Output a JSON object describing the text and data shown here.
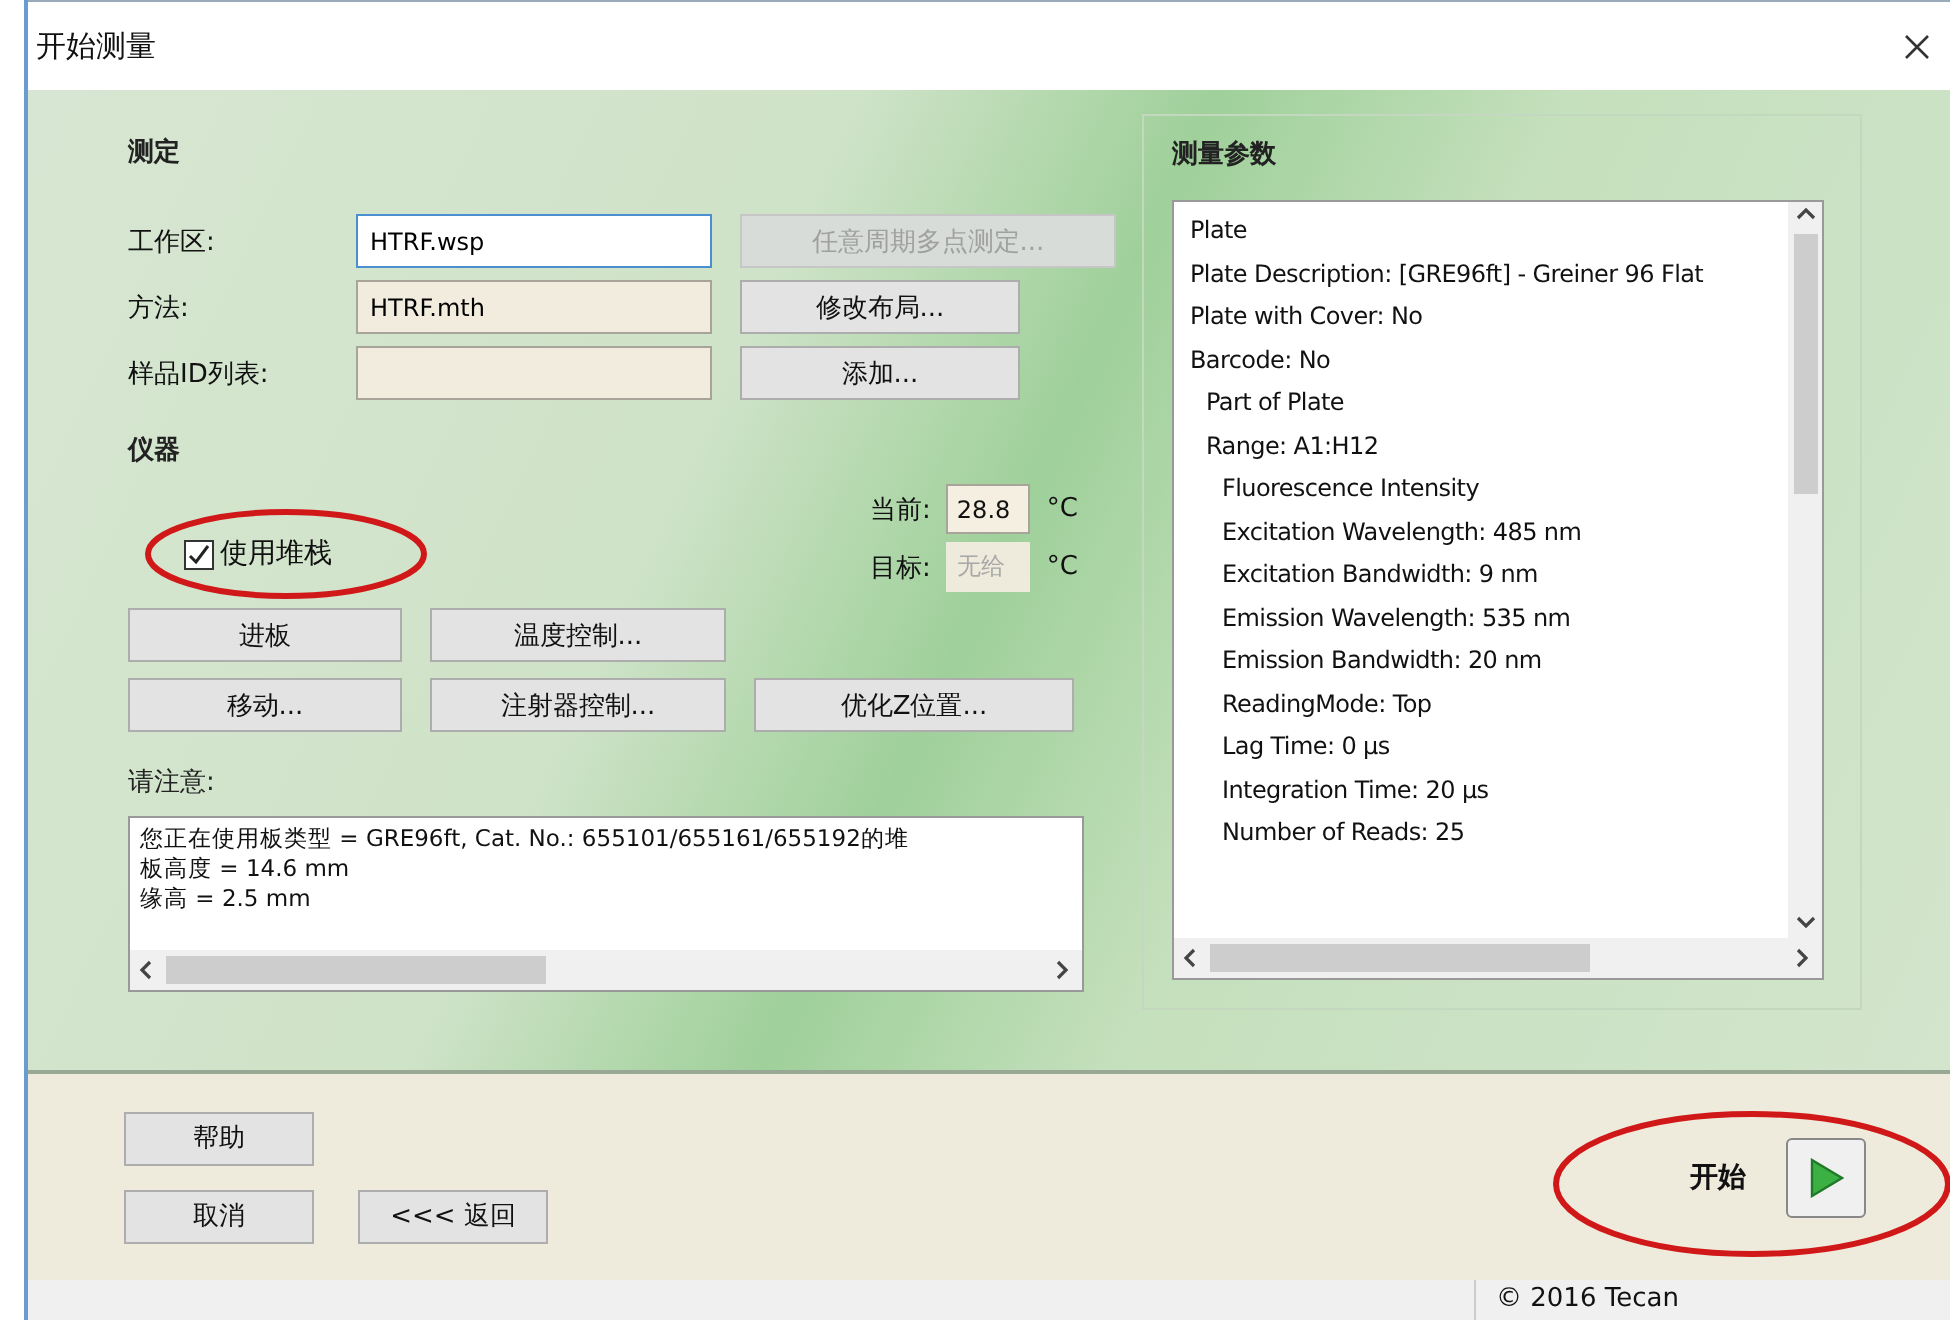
{
  "window": {
    "title": "开始测量"
  },
  "measurement": {
    "heading": "测定",
    "fields": [
      {
        "label": "工作区:",
        "value": "HTRF.wsp",
        "focused": true,
        "button": {
          "label": "任意周期多点测定...",
          "disabled": true
        }
      },
      {
        "label": "方法:",
        "value": "HTRF.mth",
        "focused": false,
        "button": {
          "label": "修改布局...",
          "disabled": false
        }
      },
      {
        "label": "样品ID列表:",
        "focused": false,
        "button": {
          "label": "添加...",
          "disabled": false
        }
      }
    ]
  },
  "instrument": {
    "heading": "仪器",
    "stacker": {
      "label": "使用堆栈",
      "checked": true
    },
    "current": {
      "label": "当前:",
      "value": "28.8",
      "unit": "°C",
      "disabled": false
    },
    "target": {
      "label": "目标:",
      "value": "无给",
      "unit": "°C",
      "disabled": true
    },
    "button_rows": [
      [
        {
          "label": "进板"
        },
        {
          "label": "温度控制..."
        }
      ],
      [
        {
          "label": "移动..."
        },
        {
          "label": "注射器控制..."
        },
        {
          "label": "优化Z位置..."
        }
      ]
    ]
  },
  "notes": {
    "heading": "请注意:",
    "lines": [
      "您正在使用板类型 = GRE96ft, Cat. No.: 655101/655161/655192的堆",
      "板高度 = 14.6 mm",
      "缘高 = 2.5 mm"
    ]
  },
  "parameters": {
    "heading": "测量参数",
    "items": [
      {
        "label": "Plate"
      },
      {
        "label": "Plate Description: [GRE96ft] - Greiner 96 Flat"
      },
      {
        "label": "Plate with Cover: No"
      },
      {
        "label": "Barcode: No",
        "children": [
          {
            "label": "Part of Plate"
          },
          {
            "label": "Range: A1:H12",
            "children": [
              {
                "label": "Fluorescence Intensity"
              },
              {
                "label": "Excitation Wavelength: 485 nm"
              },
              {
                "label": "Excitation Bandwidth: 9 nm"
              },
              {
                "label": "Emission Wavelength: 535 nm"
              },
              {
                "label": "Emission Bandwidth: 20 nm"
              },
              {
                "label": "ReadingMode: Top"
              },
              {
                "label": "Lag Time: 0 µs"
              },
              {
                "label": "Integration Time: 20 µs"
              },
              {
                "label": "Number of Reads: 25"
              }
            ]
          }
        ]
      }
    ]
  },
  "footer": {
    "help": "帮助",
    "cancel": "取消",
    "back": "<<< 返回",
    "start_label": "开始"
  },
  "status_bar": {
    "copyright": "© 2016 Tecan"
  }
}
